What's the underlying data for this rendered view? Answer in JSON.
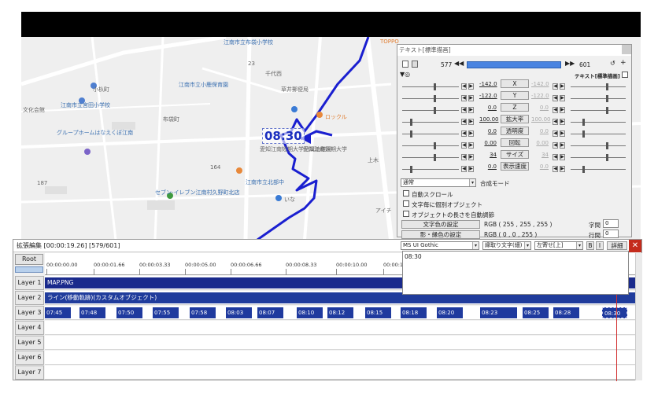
{
  "map": {
    "time_label": "08:30",
    "labels": [
      "江南市立小鹿保育園",
      "江南市立宮田小学校",
      "江南市立布袋小学校",
      "千代西",
      "草井郵便局",
      "ロックル",
      "愛知江南短期大学付属幼稚園",
      "愛知江南短期大学",
      "江南市立北部中",
      "セブン-イレブン江南村久野町北店",
      "いな",
      "アイチ",
      "グループホームはなえくぼ江南",
      "TOPPO",
      "文化会館",
      "小杁町",
      "布袋町",
      "上木"
    ],
    "road_numbers": [
      "164",
      "187",
      "23"
    ]
  },
  "timeline": {
    "title": "拡張編集 [00:00:19.26] [579/601]",
    "close": "✕",
    "root": "Root",
    "ruler": [
      "00:00:00.00",
      "00:00:01.66",
      "00:00:03.33",
      "00:00:05.00",
      "00:00:06.66",
      "00:00:08.33",
      "00:00:10.00",
      "00:00:11.66"
    ],
    "layers": [
      "Layer 1",
      "Layer 2",
      "Layer 3",
      "Layer 4",
      "Layer 5",
      "Layer 6",
      "Layer 7"
    ],
    "layer1_clip": "MAP.PNG",
    "layer2_clip": "ライン(移動軌跡)(カスタムオブジェクト)",
    "layer3_clips": [
      "07:45",
      "07:48",
      "07:50",
      "07:55",
      "07:58",
      "08:03",
      "08:07",
      "08:10",
      "08:12",
      "08:15",
      "08:18",
      "08:20",
      "08:23",
      "08:25",
      "08:28",
      "08:30"
    ]
  },
  "dialog": {
    "title": "テキスト[標準描画]",
    "frame_start": "577",
    "frame_end": "601",
    "mode_label": "テキスト[標準描画]",
    "params": [
      {
        "name": "X",
        "left": "-142.0",
        "right": "-142.0"
      },
      {
        "name": "Y",
        "left": "-122.0",
        "right": "-122.0"
      },
      {
        "name": "Z",
        "left": "0.0",
        "right": "0.0"
      },
      {
        "name": "拡大率",
        "left": "100.00",
        "right": "100.00"
      },
      {
        "name": "透明度",
        "left": "0.0",
        "right": "0.0"
      },
      {
        "name": "回転",
        "left": "0.00",
        "right": "0.00"
      },
      {
        "name": "サイズ",
        "left": "34",
        "right": "34"
      },
      {
        "name": "表示速度",
        "left": "0.0",
        "right": "0.0"
      }
    ],
    "blend_value": "通常",
    "blend_label": "合成モード",
    "checkboxes": [
      "自動スクロール",
      "文字毎に個別オブジェクト",
      "オブジェクトの長さを自動調節"
    ],
    "text_color_button": "文字色の設定",
    "text_color_value": "RGB ( 255 , 255 , 255 )",
    "shadow_color_button": "影・縁色の設定",
    "shadow_color_value": "RGB ( 0 , 0 , 255 )",
    "spacing_label": "字間",
    "spacing_value": "0",
    "line_label": "行間",
    "line_value": "0",
    "font": "MS UI Gothic",
    "outline": "縁取り文字(細)",
    "align": "左寄せ[上]",
    "bold": "B",
    "italic": "I",
    "detail": "詳細",
    "text": "08:30"
  },
  "colors": {
    "clip": "#1f3a9e",
    "route": "#1a1fd0",
    "cursor": "#d23030"
  }
}
